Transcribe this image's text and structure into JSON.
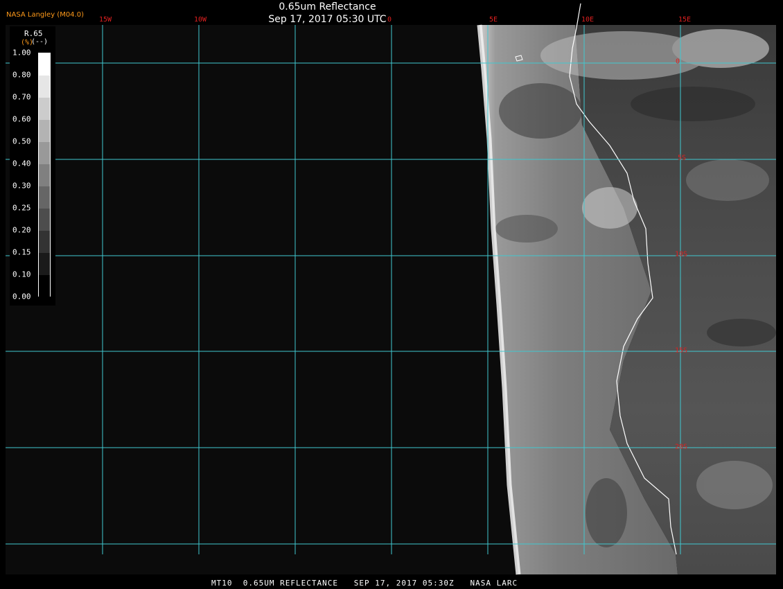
{
  "header": {
    "title": "0.65um Reflectance",
    "timestamp": "Sep 17, 2017 05:30 UTC",
    "organization": "NASA Langley (M04.0)"
  },
  "longitude_labels": [
    "15W",
    "10W",
    "5W",
    "0",
    "5E",
    "10E",
    "15E"
  ],
  "latitude_labels": [
    "0",
    "5S",
    "10S",
    "15S",
    "20S"
  ],
  "legend": {
    "product": "R.65",
    "unit_marker": "(%)",
    "unit_text": "(--)",
    "ticks": [
      "1.00",
      "0.80",
      "0.70",
      "0.60",
      "0.50",
      "0.40",
      "0.30",
      "0.25",
      "0.20",
      "0.15",
      "0.10",
      "0.00"
    ]
  },
  "footer": "MT10  0.65UM REFLECTANCE   SEP 17, 2017 05:30Z   NASA LARC",
  "colors": {
    "grid": "#40c8d0",
    "lat_lon_labels": "#e02020",
    "header_org": "#ff9a1a",
    "background": "#0b0b0b",
    "coastline": "#ffffff"
  }
}
